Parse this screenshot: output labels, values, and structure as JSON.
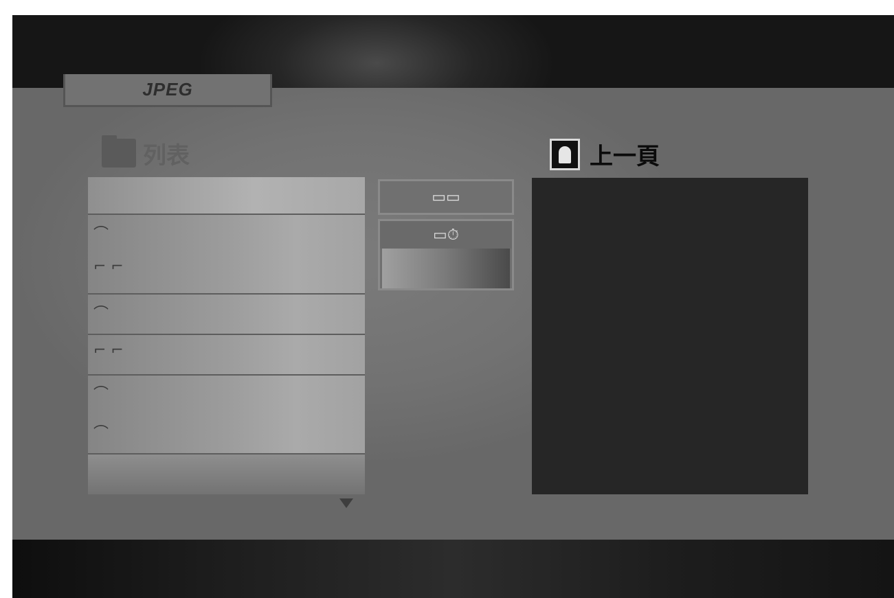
{
  "mode_tab": {
    "label": "JPEG"
  },
  "file_list": {
    "title": "列表",
    "folder_icon": "folder-icon",
    "rows": [
      {
        "glyph": ""
      },
      {
        "glyph": "⌒"
      },
      {
        "glyph": "⌐ ⌐"
      },
      {
        "glyph": "⌒"
      },
      {
        "glyph": "⌐ ⌐"
      },
      {
        "glyph": "⌒"
      },
      {
        "glyph": "⌒"
      }
    ],
    "scroll_icon": "triangle-down-icon"
  },
  "controls": {
    "play_glyph": "▭▭",
    "slideshow_glyph": "▭⏱"
  },
  "preview": {
    "title": "上一頁",
    "icon": "photo-icon"
  }
}
